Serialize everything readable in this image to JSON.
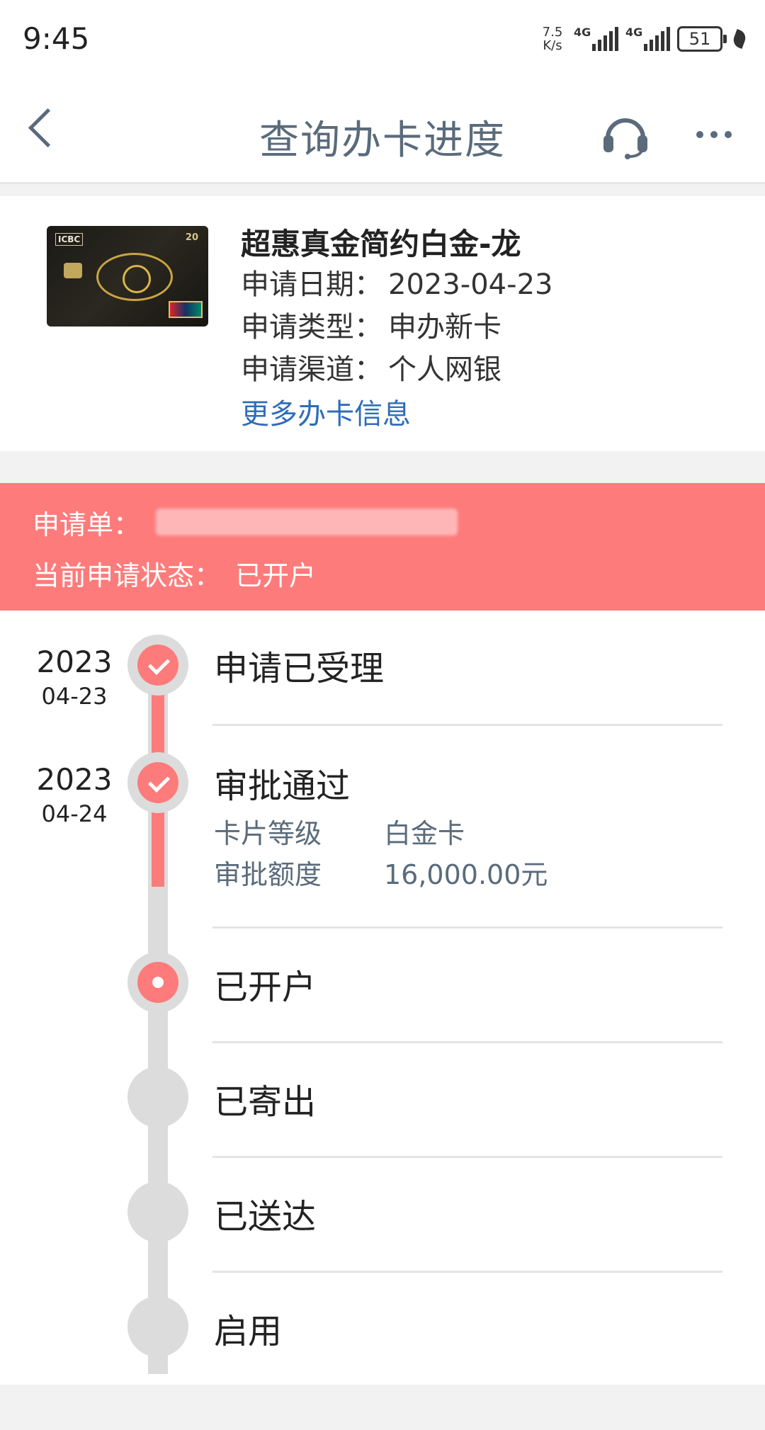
{
  "status_bar": {
    "time": "9:45",
    "net_speed_value": "7.5",
    "net_speed_unit": "K/s",
    "signal1_label": "4G",
    "signal2_label": "4G",
    "battery": "51"
  },
  "nav": {
    "title": "查询办卡进度"
  },
  "card": {
    "name": "超惠真金简约白金-龙",
    "apply_date_label": "申请日期：",
    "apply_date": "2023-04-23",
    "apply_type_label": "申请类型：",
    "apply_type": "申办新卡",
    "apply_channel_label": "申请渠道：",
    "apply_channel": "个人网银",
    "more_info_link": "更多办卡信息",
    "image_logo": "ICBC",
    "image_badge": "20"
  },
  "banner": {
    "application_no_label": "申请单：",
    "current_status_label": "当前申请状态：",
    "current_status": "已开户",
    "background_color": "#fe7b7b"
  },
  "timeline": {
    "steps": [
      {
        "title": "申请已受理",
        "year": "2023",
        "date": "04-23",
        "state": "done"
      },
      {
        "title": "审批通过",
        "year": "2023",
        "date": "04-24",
        "state": "done",
        "details": [
          {
            "label": "卡片等级",
            "value": "白金卡"
          },
          {
            "label": "审批额度",
            "value": "16,000.00元"
          }
        ]
      },
      {
        "title": "已开户",
        "state": "current"
      },
      {
        "title": "已寄出",
        "state": "pending"
      },
      {
        "title": "已送达",
        "state": "pending"
      },
      {
        "title": "启用",
        "state": "pending"
      }
    ]
  }
}
